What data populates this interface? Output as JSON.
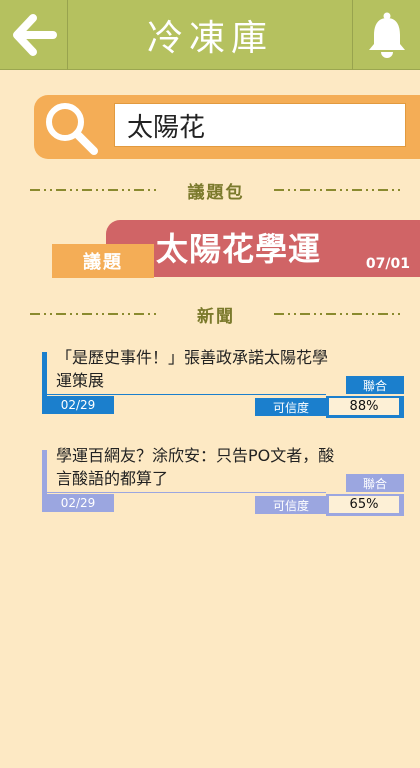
{
  "header": {
    "title": "冷凍庫"
  },
  "search": {
    "value": "太陽花",
    "placeholder": ""
  },
  "sections": {
    "topic_pack": "議題包",
    "news": "新聞"
  },
  "topic": {
    "tag": "議題",
    "title": "太陽花學運",
    "date": "07/01"
  },
  "news": [
    {
      "headline": "「是歷史事件！」張善政承諾太陽花學運策展",
      "date": "02/29",
      "credibility_label": "可信度",
      "credibility": "88%",
      "source": "聯合",
      "accent_color": "#1b7fcd"
    },
    {
      "headline": "學運百網友？涂欣安：只告PO文者，酸言酸語的都算了",
      "date": "02/29",
      "credibility_label": "可信度",
      "credibility": "65%",
      "source": "聯合",
      "accent_color": "#9ba6e0"
    }
  ],
  "colors": {
    "header_bg": "#b5c15f",
    "background": "#fde9c4",
    "search_bg": "#f4ad56",
    "topic_banner": "#d06466",
    "topic_tag": "#f4ad56",
    "news_primary": "#1b7fcd",
    "news_secondary": "#9ba6e0"
  },
  "icons": {
    "back": "arrow-left-icon",
    "notifications": "bell-icon",
    "search": "magnifier-icon"
  }
}
